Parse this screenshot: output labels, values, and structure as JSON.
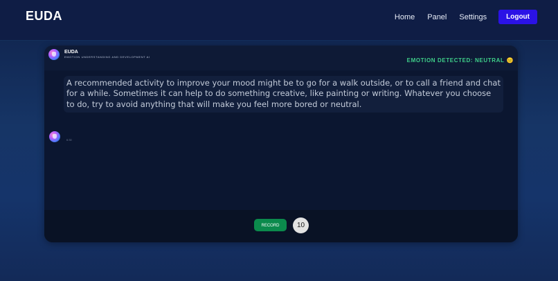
{
  "app": {
    "brand": "EUDA"
  },
  "nav": {
    "links": [
      "Home",
      "Panel",
      "Settings"
    ],
    "logout_label": "Logout"
  },
  "chat": {
    "header": {
      "name": "EUDA",
      "subtitle": "EMOTION UNDERSTANDING AND DEVELOPMENT AI",
      "emotion_label": "EMOTION DETECTED: NEUTRAL",
      "emotion_emoji": "😐",
      "emotion_color": "#3fd08a"
    },
    "messages": [
      {
        "text": "A recommended activity to improve your mood might be to go for a walk outside, or to call a friend and chat for a while. Sometimes it can help to do something creative, like painting or writing. Whatever you choose to do, try to avoid anything that will make you feel more bored or neutral.",
        "time": "6:30"
      }
    ],
    "footer": {
      "record_label": "RECORD",
      "timer": "10"
    }
  },
  "colors": {
    "accent_button": "#2b12e6",
    "record_button": "#0b8a4c"
  }
}
